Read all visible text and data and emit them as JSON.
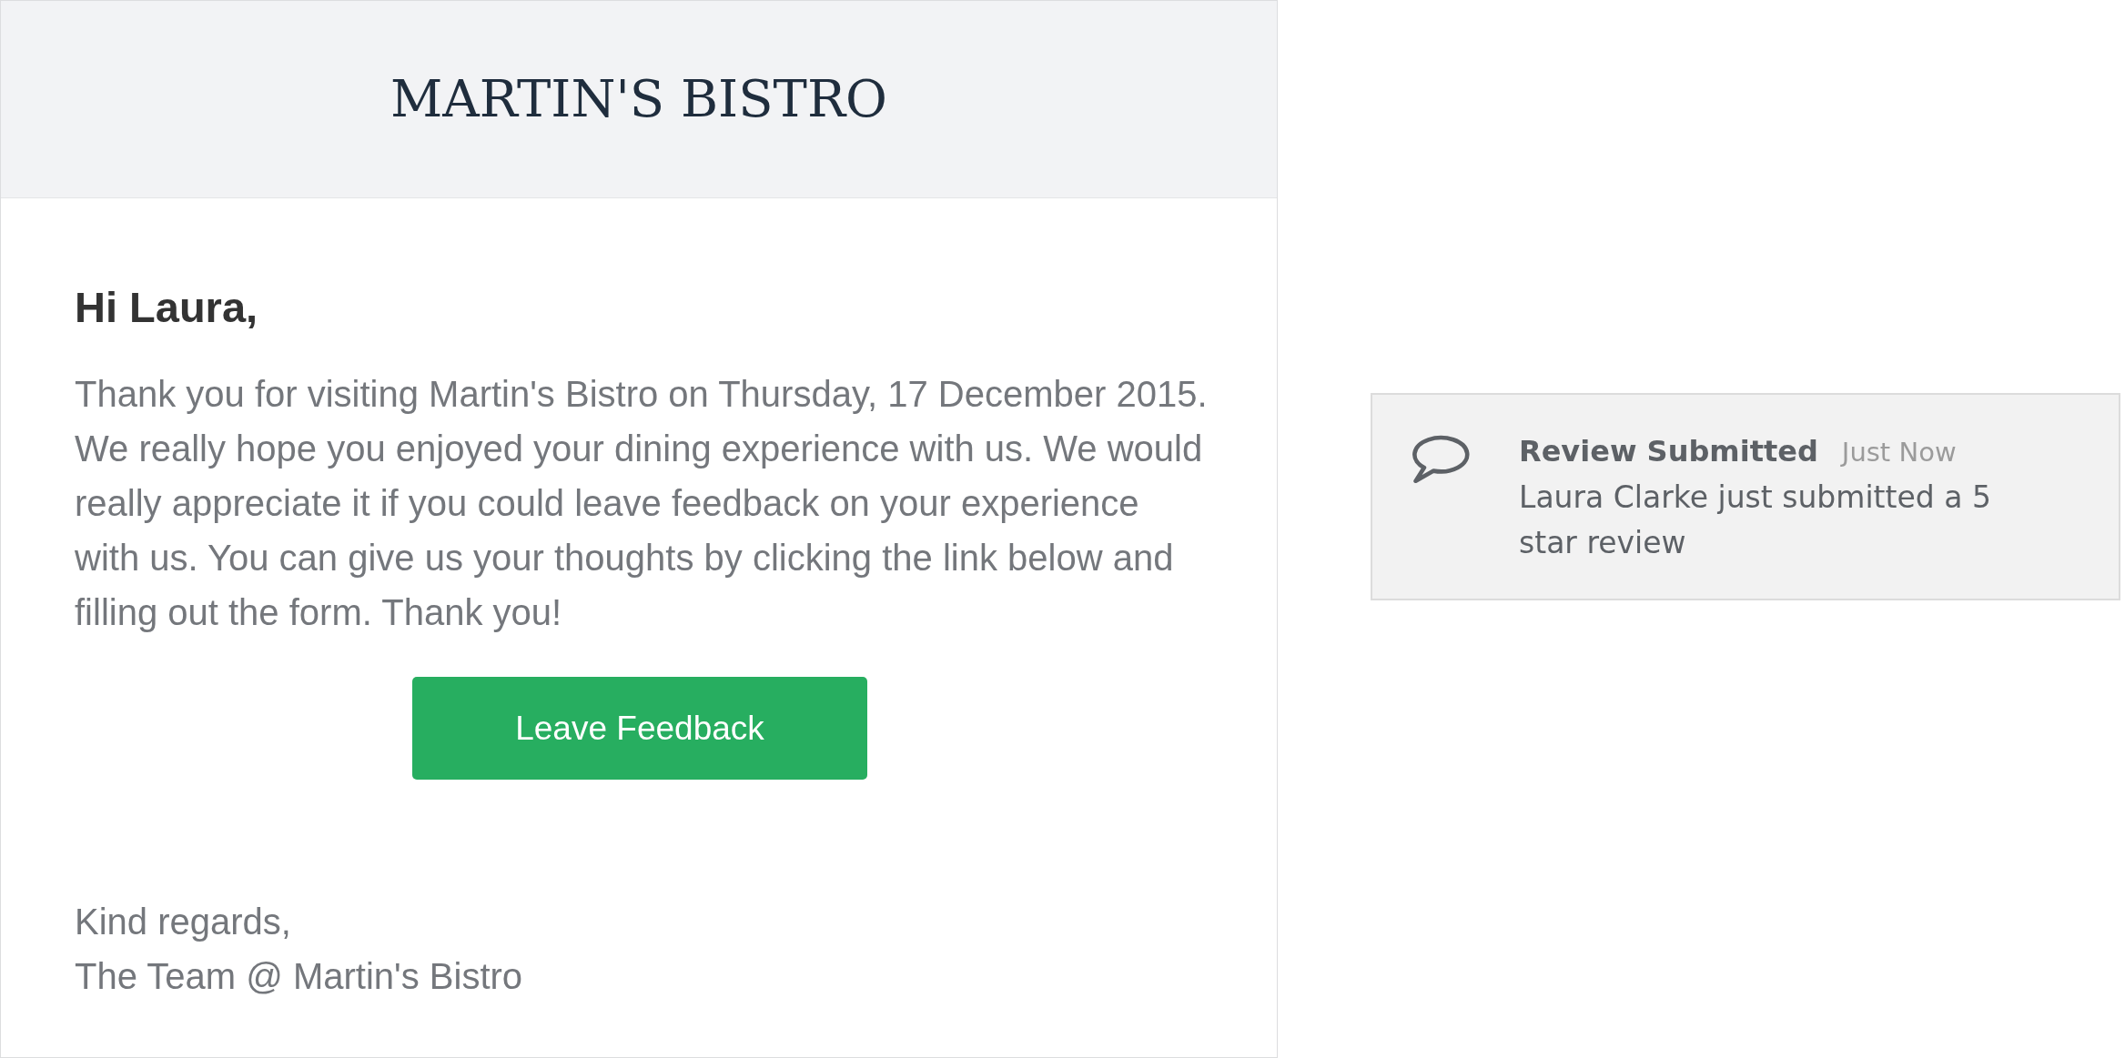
{
  "email": {
    "brand": "MARTIN'S BISTRO",
    "greeting": "Hi Laura,",
    "message": "Thank you for visiting Martin's Bistro on Thursday, 17 December 2015. We really hope you enjoyed your dining experience with us. We would really appreciate it if you could leave feedback on your experience with us. You can give us your thoughts by clicking the link below and filling out the form. Thank you!",
    "button": "Leave Feedback",
    "signoff": [
      "Kind regards,",
      "The Team @ Martin's Bistro"
    ]
  },
  "notification": {
    "title": "Review Submitted",
    "time": "Just Now",
    "text": "Laura Clarke just submitted a 5 star review"
  }
}
